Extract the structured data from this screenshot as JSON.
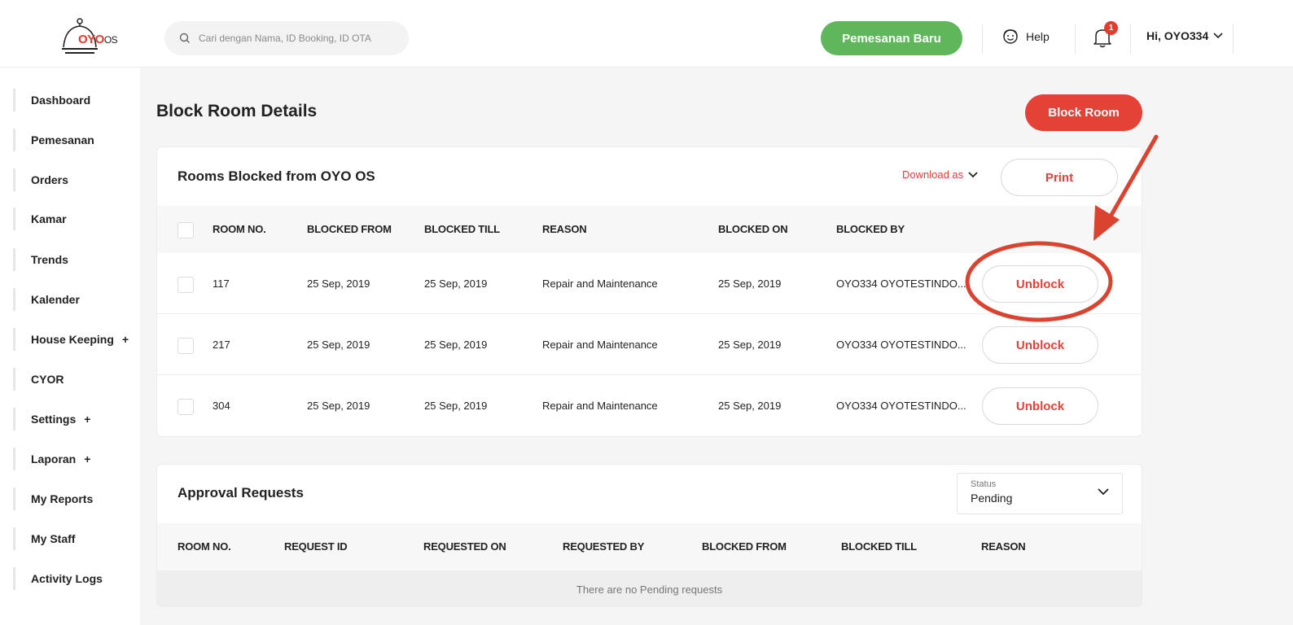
{
  "header": {
    "logo_text": "OYO",
    "logo_suffix": "OS",
    "search_placeholder": "Cari dengan Nama, ID Booking, ID OTA",
    "new_booking_label": "Pemesanan Baru",
    "help_label": "Help",
    "notification_count": "1",
    "user_greeting": "Hi, OYO334"
  },
  "sidebar": {
    "items": [
      {
        "label": "Dashboard"
      },
      {
        "label": "Pemesanan"
      },
      {
        "label": "Orders"
      },
      {
        "label": "Kamar"
      },
      {
        "label": "Trends"
      },
      {
        "label": "Kalender"
      },
      {
        "label": "House Keeping",
        "expand": "+"
      },
      {
        "label": "CYOR"
      },
      {
        "label": "Settings",
        "expand": "+"
      },
      {
        "label": "Laporan",
        "expand": "+"
      },
      {
        "label": "My Reports"
      },
      {
        "label": "My Staff"
      },
      {
        "label": "Activity Logs"
      }
    ]
  },
  "page": {
    "title": "Block Room Details",
    "block_room_label": "Block Room"
  },
  "blocked_card": {
    "title": "Rooms Blocked from OYO OS",
    "download_label": "Download as",
    "print_label": "Print",
    "columns": [
      "ROOM NO.",
      "BLOCKED FROM",
      "BLOCKED TILL",
      "REASON",
      "BLOCKED ON",
      "BLOCKED BY"
    ],
    "unblock_label": "Unblock",
    "rows": [
      {
        "room": "117",
        "from": "25 Sep, 2019",
        "till": "25 Sep, 2019",
        "reason": "Repair and Maintenance",
        "on": "25 Sep, 2019",
        "by": "OYO334 OYOTESTINDO..."
      },
      {
        "room": "217",
        "from": "25 Sep, 2019",
        "till": "25 Sep, 2019",
        "reason": "Repair and Maintenance",
        "on": "25 Sep, 2019",
        "by": "OYO334 OYOTESTINDO..."
      },
      {
        "room": "304",
        "from": "25 Sep, 2019",
        "till": "25 Sep, 2019",
        "reason": "Repair and Maintenance",
        "on": "25 Sep, 2019",
        "by": "OYO334 OYOTESTINDO..."
      }
    ]
  },
  "approval_card": {
    "title": "Approval Requests",
    "status_label": "Status",
    "status_value": "Pending",
    "columns": [
      "ROOM NO.",
      "REQUEST ID",
      "REQUESTED ON",
      "REQUESTED BY",
      "BLOCKED FROM",
      "BLOCKED TILL",
      "REASON"
    ],
    "empty_message": "There are no Pending requests"
  },
  "colors": {
    "brand_red": "#e44137",
    "new_booking_green": "#5fb65b",
    "annotation_red": "#d9432f"
  }
}
